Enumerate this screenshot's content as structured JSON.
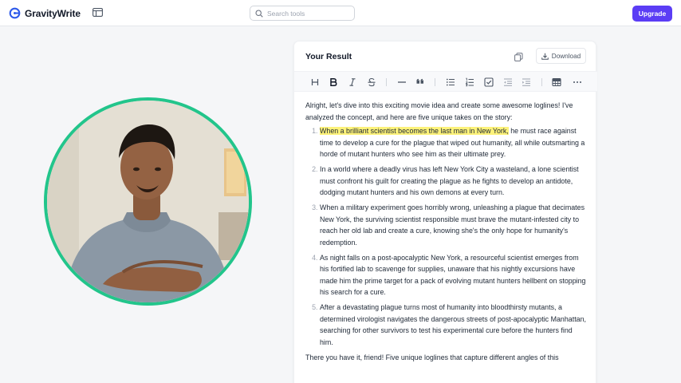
{
  "app": {
    "brand": "GravityWrite",
    "brand_color": "#2f5bea",
    "accent_color": "#5b3df5"
  },
  "search": {
    "placeholder": "Search tools"
  },
  "header": {
    "upgrade_label": "Upgrade"
  },
  "video": {
    "ring_color": "#22c58b"
  },
  "result": {
    "title": "Your Result",
    "download_label": "Download",
    "toolbar": [
      "heading-icon",
      "bold-icon",
      "italic-icon",
      "strikethrough-icon",
      "horizontal-rule-icon",
      "quote-icon",
      "bullet-list-icon",
      "ordered-list-icon",
      "task-list-icon",
      "outdent-icon",
      "indent-icon",
      "table-icon",
      "more-icon"
    ],
    "intro": "Alright, let's dive into this exciting movie idea and create some awesome loglines! I've analyzed the concept, and here are five unique takes on the story:",
    "items": [
      {
        "highlight": "When a brilliant scientist becomes the last man in New York,",
        "text": " he must race against time to develop a cure for the plague that wiped out humanity, all while outsmarting a horde of mutant hunters who see him as their ultimate prey."
      },
      {
        "highlight": "",
        "text": "In a world where a deadly virus has left New York City a wasteland, a lone scientist must confront his guilt for creating the plague as he fights to develop an antidote, dodging mutant hunters and his own demons at every turn."
      },
      {
        "highlight": "",
        "text": "When a military experiment goes horribly wrong, unleashing a plague that decimates New York, the surviving scientist responsible must brave the mutant-infested city to reach her old lab and create a cure, knowing she's the only hope for humanity's redemption."
      },
      {
        "highlight": "",
        "text": "As night falls on a post-apocalyptic New York, a resourceful scientist emerges from his fortified lab to scavenge for supplies, unaware that his nightly excursions have made him the prime target for a pack of evolving mutant hunters hellbent on stopping his search for a cure."
      },
      {
        "highlight": "",
        "text": "After a devastating plague turns most of humanity into bloodthirsty mutants, a determined virologist navigates the dangerous streets of post-apocalyptic Manhattan, searching for other survivors to test his experimental cure before the hunters find him."
      }
    ],
    "outro": "There you have it, friend! Five unique loglines that capture different angles of this"
  }
}
